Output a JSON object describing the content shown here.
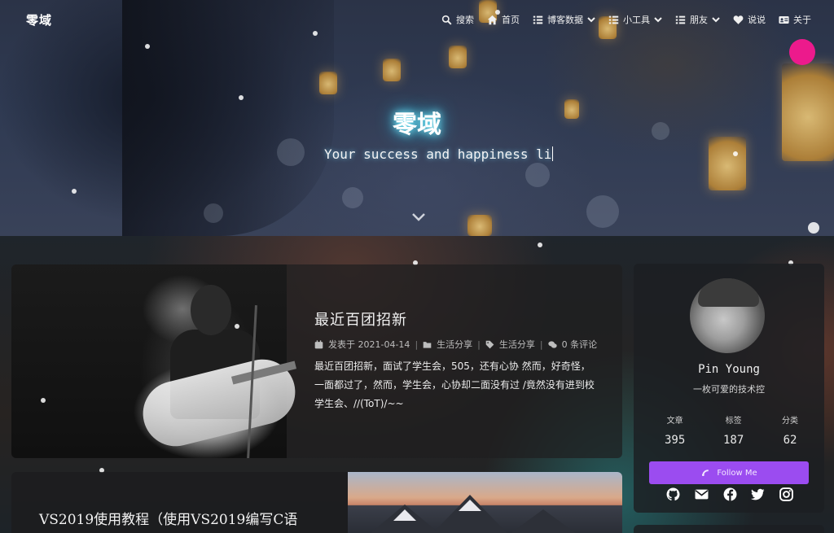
{
  "site": {
    "brand": "零域"
  },
  "nav": {
    "items": [
      {
        "label": "搜索",
        "icon": "search-icon",
        "dropdown": false
      },
      {
        "label": "首页",
        "icon": "home-icon",
        "dropdown": false
      },
      {
        "label": "博客数据",
        "icon": "list-icon",
        "dropdown": true
      },
      {
        "label": "小工具",
        "icon": "list-icon",
        "dropdown": true
      },
      {
        "label": "朋友",
        "icon": "list-icon",
        "dropdown": true
      },
      {
        "label": "说说",
        "icon": "heart-icon",
        "dropdown": false
      },
      {
        "label": "关于",
        "icon": "id-card-icon",
        "dropdown": false
      }
    ]
  },
  "hero": {
    "title": "零域",
    "subtitle": "Your success and happiness li"
  },
  "posts": [
    {
      "title": "最近百团招新",
      "meta": {
        "date": "发表于 2021-04-14",
        "category": "生活分享",
        "tag": "生活分享",
        "comments": "0 条评论"
      },
      "excerpt": "最近百团招新，面试了学生会，505，还有心协 然而，好奇怪，一面都过了，然而，学生会，心协却二面没有过 /竟然没有进到校学生会、//(ToT)/~~"
    },
    {
      "title": "VS2019使用教程（使用VS2019编写C语"
    }
  ],
  "sidebar": {
    "author": "Pin Young",
    "tagline": "一枚可爱的技术控",
    "stats": [
      {
        "label": "文章",
        "value": "395"
      },
      {
        "label": "标签",
        "value": "187"
      },
      {
        "label": "分类",
        "value": "62"
      }
    ],
    "follow_label": "Follow Me",
    "socials": [
      "github-icon",
      "email-icon",
      "facebook-icon",
      "twitter-icon",
      "instagram-icon"
    ]
  },
  "colors": {
    "accent_pink": "#ec1a8c",
    "follow_purple": "#9b4cf0",
    "title_glow": "#2ad0ff"
  }
}
